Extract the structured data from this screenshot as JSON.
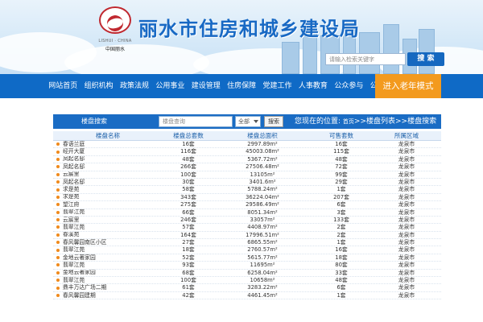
{
  "header": {
    "logo_en": "LISHUI · CHINA",
    "logo_cn": "中国丽水",
    "title": "丽水市住房和城乡建设局",
    "search_placeholder": "请输入检索关键字",
    "search_button": "搜 索"
  },
  "nav": {
    "items": [
      "网站首页",
      "组织机构",
      "政策法规",
      "公用事业",
      "建设管理",
      "住房保障",
      "党建工作",
      "人事教育",
      "公众参与",
      "公示公告"
    ],
    "special": "进入老年模式"
  },
  "search_panel": {
    "title": "楼盘搜索",
    "keyword_placeholder": "楼盘查询",
    "select_value": "全部",
    "button": "搜索",
    "location_prefix": "您现在的位置:",
    "location_home": "首页",
    "location_rest": ">>楼盘列表>>楼盘搜索"
  },
  "table": {
    "headers": [
      "楼盘名称",
      "楼盘总套数",
      "楼盘总面积",
      "可售套数",
      "所属区域"
    ],
    "rows": [
      [
        "春语兰庭",
        "16套",
        "2997.89m²",
        "16套",
        "龙泉市"
      ],
      [
        "经开大厦",
        "116套",
        "45003.08m²",
        "115套",
        "龙泉市"
      ],
      [
        "凤起名邸",
        "48套",
        "5367.72m²",
        "48套",
        "龙泉市"
      ],
      [
        "凤起名邸",
        "266套",
        "27506.48m²",
        "72套",
        "龙泉市"
      ],
      [
        "云宸里",
        "100套",
        "13105m²",
        "99套",
        "龙泉市"
      ],
      [
        "凤起名邸",
        "30套",
        "3401.6m²",
        "29套",
        "龙泉市"
      ],
      [
        "求是苑",
        "58套",
        "5788.24m²",
        "1套",
        "龙泉市"
      ],
      [
        "求是苑",
        "343套",
        "36224.04m²",
        "207套",
        "龙泉市"
      ],
      [
        "望江府",
        "275套",
        "29586.49m²",
        "6套",
        "龙泉市"
      ],
      [
        "翡翠江苑",
        "66套",
        "8051.34m²",
        "3套",
        "龙泉市"
      ],
      [
        "云宸里",
        "246套",
        "33057m²",
        "133套",
        "龙泉市"
      ],
      [
        "翡翠江苑",
        "57套",
        "4408.97m²",
        "2套",
        "龙泉市"
      ],
      [
        "春溪苑",
        "164套",
        "17996.51m²",
        "2套",
        "龙泉市"
      ],
      [
        "春风馨园南区小区",
        "27套",
        "6865.55m²",
        "1套",
        "龙泉市"
      ],
      [
        "翡翠江苑",
        "18套",
        "2760.57m²",
        "16套",
        "龙泉市"
      ],
      [
        "金地云著家园",
        "52套",
        "5615.77m²",
        "18套",
        "龙泉市"
      ],
      [
        "翡翠江苑",
        "93套",
        "11695m²",
        "80套",
        "龙泉市"
      ],
      [
        "金地云著家园",
        "68套",
        "6258.04m²",
        "33套",
        "龙泉市"
      ],
      [
        "翡翠江苑",
        "100套",
        "10658m²",
        "48套",
        "龙泉市"
      ],
      [
        "鼎丰万达广场二期",
        "61套",
        "3283.22m²",
        "6套",
        "龙泉市"
      ],
      [
        "春风馨园建期",
        "42套",
        "4461.45m²",
        "1套",
        "龙泉市"
      ]
    ]
  },
  "colors": {
    "nav": "#0f6ac6",
    "title": "#1869c4",
    "accent": "#f39a1e"
  }
}
